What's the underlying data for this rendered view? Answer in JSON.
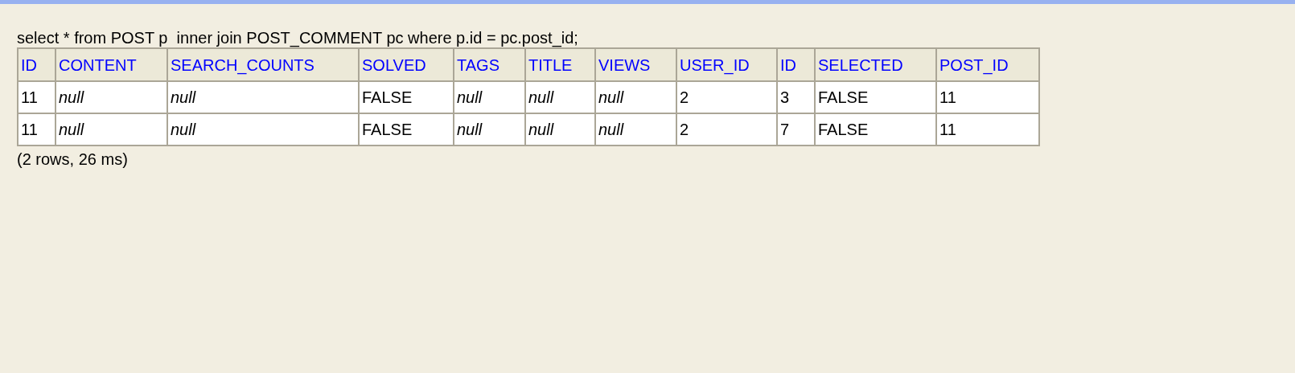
{
  "query": "select * from POST p  inner join POST_COMMENT pc where p.id = pc.post_id;",
  "table": {
    "columns": [
      "ID",
      "CONTENT",
      "SEARCH_COUNTS",
      "SOLVED",
      "TAGS",
      "TITLE",
      "VIEWS",
      "USER_ID",
      "ID",
      "SELECTED",
      "POST_ID"
    ],
    "rows": [
      [
        {
          "text": "11",
          "kind": "value"
        },
        {
          "text": "null",
          "kind": "null"
        },
        {
          "text": "null",
          "kind": "null"
        },
        {
          "text": "FALSE",
          "kind": "value"
        },
        {
          "text": "null",
          "kind": "null"
        },
        {
          "text": "null",
          "kind": "null"
        },
        {
          "text": "null",
          "kind": "null"
        },
        {
          "text": "2",
          "kind": "value"
        },
        {
          "text": "3",
          "kind": "value"
        },
        {
          "text": "FALSE",
          "kind": "value"
        },
        {
          "text": "11",
          "kind": "value"
        }
      ],
      [
        {
          "text": "11",
          "kind": "value"
        },
        {
          "text": "null",
          "kind": "null"
        },
        {
          "text": "null",
          "kind": "null"
        },
        {
          "text": "FALSE",
          "kind": "value"
        },
        {
          "text": "null",
          "kind": "null"
        },
        {
          "text": "null",
          "kind": "null"
        },
        {
          "text": "null",
          "kind": "null"
        },
        {
          "text": "2",
          "kind": "value"
        },
        {
          "text": "7",
          "kind": "value"
        },
        {
          "text": "FALSE",
          "kind": "value"
        },
        {
          "text": "11",
          "kind": "value"
        }
      ]
    ]
  },
  "status": "(2 rows, 26 ms)"
}
